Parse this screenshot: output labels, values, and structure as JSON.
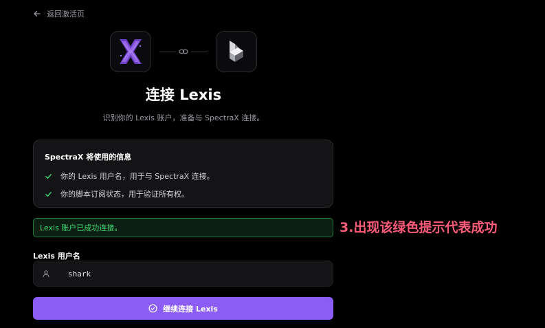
{
  "nav": {
    "back_label": "返回激活页"
  },
  "header": {
    "title": "连接 Lexis",
    "subtitle": "识别你的 Lexis 账户，准备与 SpectraX 连接。"
  },
  "info_card": {
    "title": "SpectraX 将使用的信息",
    "items": [
      {
        "icon": "check-icon",
        "text": "你的 Lexis 用户名，用于与 SpectraX 连接。"
      },
      {
        "icon": "check-icon",
        "text": "你的脚本订阅状态，用于验证所有权。"
      }
    ]
  },
  "status": {
    "message": "Lexis 账户已成功连接。"
  },
  "annotation": {
    "text": "3.出现该绿色提示代表成功"
  },
  "form": {
    "username_label": "Lexis 用户名",
    "username_value": "shark"
  },
  "actions": {
    "continue_label": "继续连接 Lexis"
  },
  "colors": {
    "background": "#000000",
    "accent": "#8b5cf6",
    "success": "#3ddc74",
    "annotation": "#ff5c7a"
  },
  "icons": {
    "back": "arrow-left-icon",
    "spectrax_logo": "spectrax-logo",
    "lexis_logo": "lexis-logo",
    "link": "link-icon",
    "user": "user-icon",
    "continue": "check-circle-icon"
  }
}
